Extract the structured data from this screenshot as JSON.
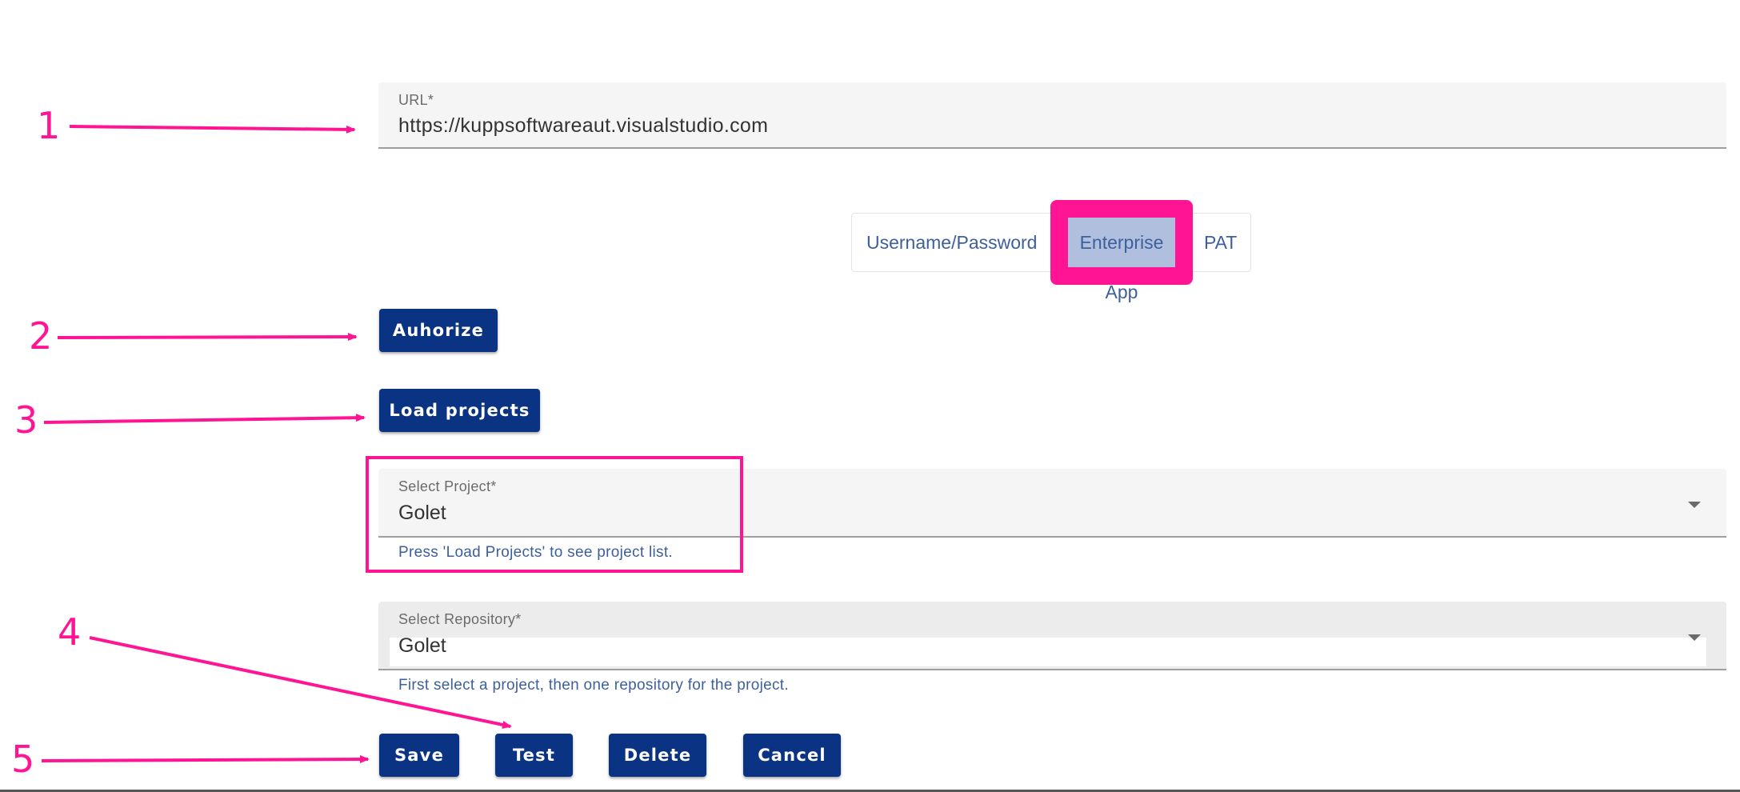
{
  "url_field": {
    "label": "URL*",
    "value": "https://kuppsoftwareaut.visualstudio.com"
  },
  "auth_tabs": [
    {
      "label": "Username/Password",
      "selected": false
    },
    {
      "label": "Enterprise App",
      "selected": true
    },
    {
      "label": "PAT",
      "selected": false
    }
  ],
  "buttons": {
    "authorize": "Auhorize",
    "load_projects": "Load projects",
    "save": "Save",
    "test": "Test",
    "delete": "Delete",
    "cancel": "Cancel"
  },
  "project_select": {
    "label": "Select Project*",
    "value": "Golet",
    "hint": "Press 'Load Projects' to see project list."
  },
  "repository_select": {
    "label": "Select Repository*",
    "value": "Golet",
    "hint": "First select a project, then one repository for the project."
  },
  "annotations": {
    "n1": "1",
    "n2": "2",
    "n3": "3",
    "n4": "4",
    "n5": "5",
    "color": "#ff1493"
  },
  "colors": {
    "primary_button": "#0b3383",
    "highlight": "#ff1493",
    "selected_tab": "#b0bfdd",
    "tab_text": "#3d5f9c"
  }
}
